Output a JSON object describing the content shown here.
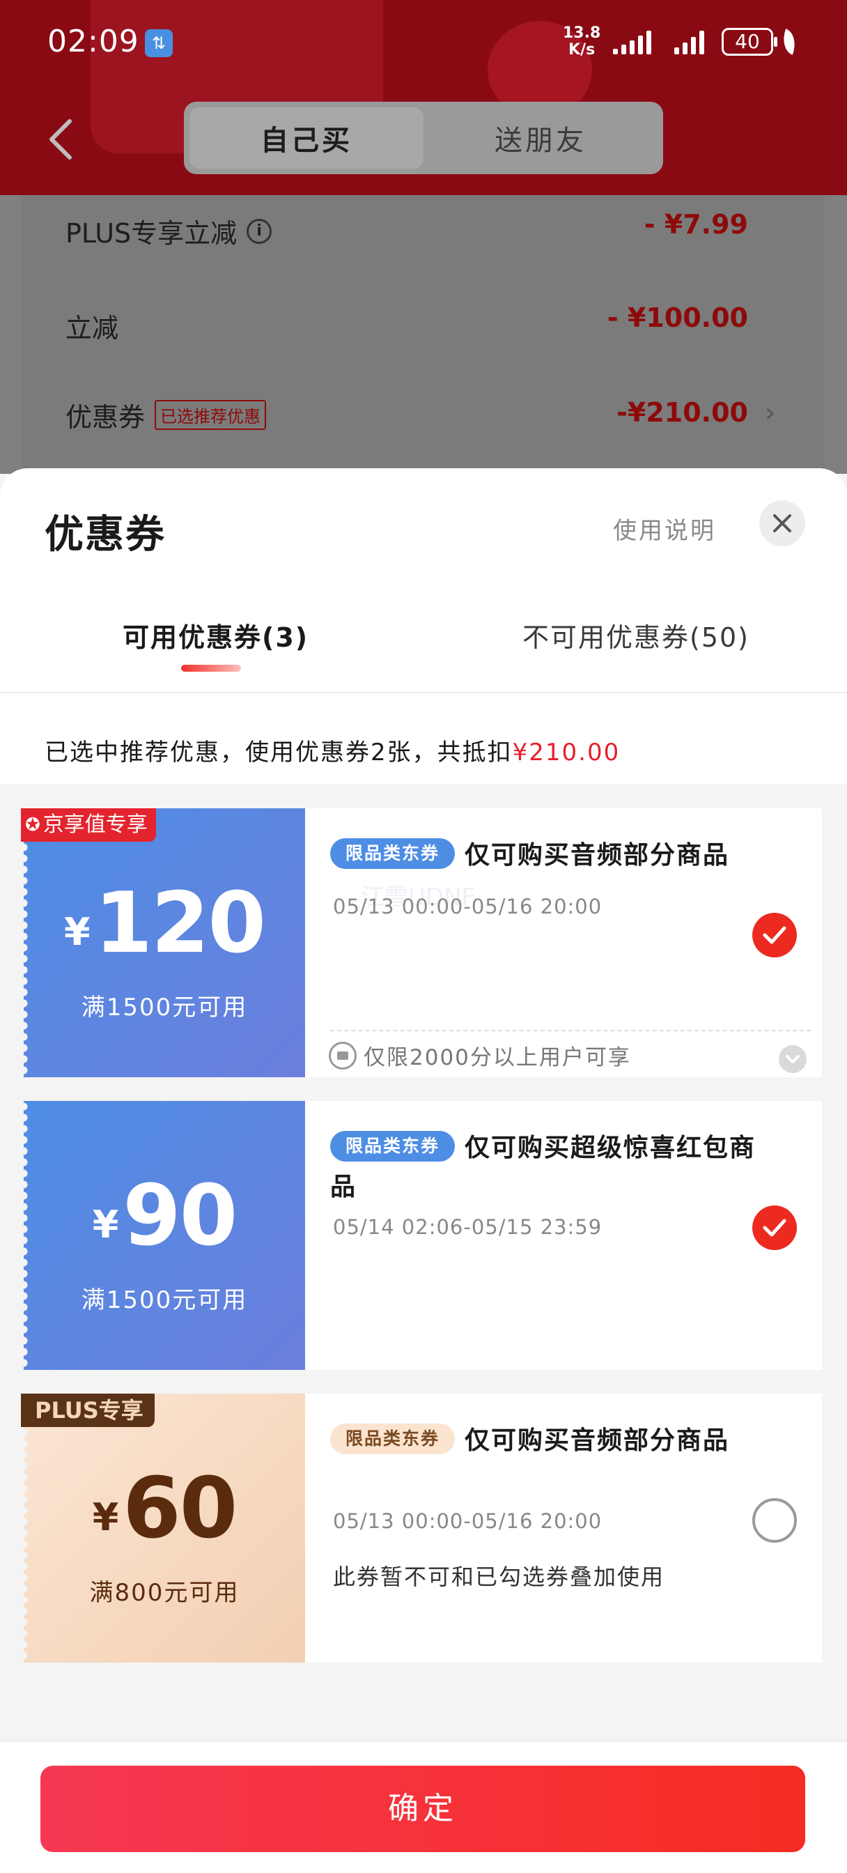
{
  "status_bar": {
    "time": "02:09",
    "net_speed": "13.8",
    "net_unit": "K/s",
    "battery": "40",
    "app_icon": "data-transfer-icon"
  },
  "nav": {
    "back_icon": "chevron-left-icon",
    "tabs": [
      {
        "label": "自己买",
        "active": true
      },
      {
        "label": "送朋友",
        "active": false
      }
    ]
  },
  "price_rows": [
    {
      "label": "PLUS专享立减",
      "value": "- ¥7.99"
    },
    {
      "label": "立减",
      "value": "- ¥100.00"
    },
    {
      "label": "优惠券",
      "tag": "已选推荐优惠",
      "value": "-¥210.00"
    }
  ],
  "sheet": {
    "title": "优惠券",
    "usage_link": "使用说明",
    "tabs": [
      {
        "label": "可用优惠券(3)",
        "active": true
      },
      {
        "label": "不可用优惠券(50)",
        "active": false
      }
    ],
    "summary_prefix": "已选中推荐优惠，使用优惠券2张，共抵扣",
    "summary_amount": "¥210.00"
  },
  "coupons": [
    {
      "ribbon": "京享值专享",
      "currency": "¥",
      "amount": "120",
      "condition": "满1500元可用",
      "tag": "限品类东券",
      "title": "仅可购买音频部分商品",
      "date": "05/13 00:00-05/16 20:00",
      "watermark": "江雪UDNF",
      "selected": true,
      "limit_note": "仅限2000分以上用户可享"
    },
    {
      "currency": "¥",
      "amount": "90",
      "condition": "满1500元可用",
      "tag": "限品类东券",
      "title": "仅可购买超级惊喜红包商品",
      "date": "05/14 02:06-05/15 23:59",
      "selected": true
    },
    {
      "ribbon": "PLUS专享",
      "currency": "¥",
      "amount": "60",
      "condition": "满800元可用",
      "tag": "限品类东券",
      "title": "仅可购买音频部分商品",
      "date": "05/13 00:00-05/16 20:00",
      "note": "此券暂不可和已勾选券叠加使用",
      "selected": false
    }
  ],
  "footer": {
    "confirm_label": "确定"
  },
  "colors": {
    "accent_red": "#e5202d",
    "coupon_blue": "#4e8de4",
    "plus_brown": "#5a3317"
  }
}
